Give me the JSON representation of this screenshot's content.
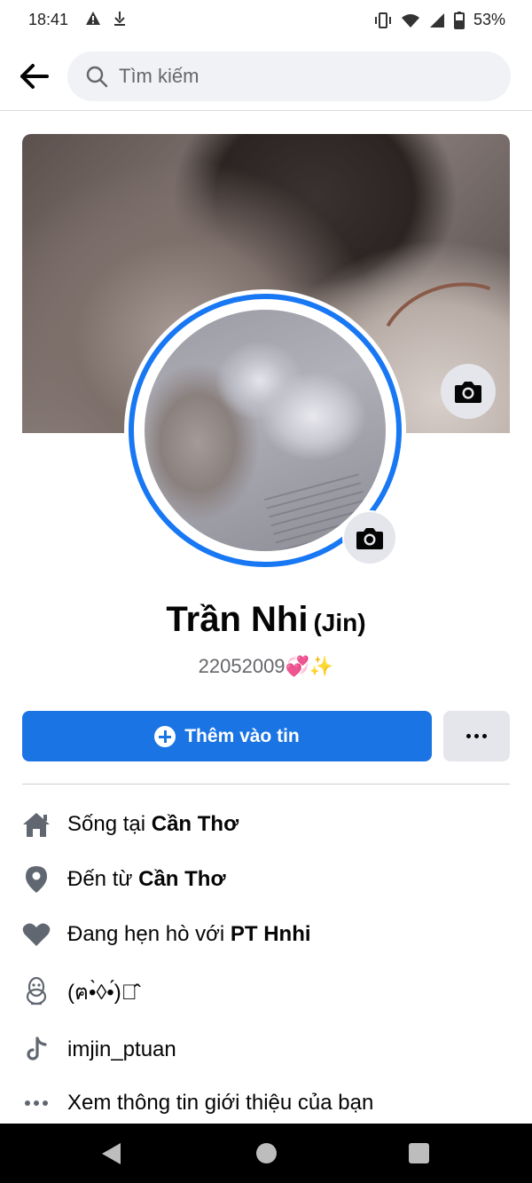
{
  "status_bar": {
    "time": "18:41",
    "battery": "53%",
    "icons": [
      "warning-icon",
      "download-icon",
      "vibrate-icon",
      "wifi-icon",
      "signal-icon",
      "battery-icon"
    ]
  },
  "search": {
    "placeholder": "Tìm kiếm"
  },
  "profile": {
    "name": "Trần Nhi",
    "alt_name": "(Jin)",
    "bio": "22052009💞✨"
  },
  "actions": {
    "add_story_label": "Thêm vào tin",
    "more_label": "..."
  },
  "info": [
    {
      "icon": "home-icon",
      "prefix": "Sống tại ",
      "bold": "Cần Thơ"
    },
    {
      "icon": "location-pin-icon",
      "prefix": "Đến từ ",
      "bold": "Cần Thơ"
    },
    {
      "icon": "heart-icon",
      "prefix": "Đang hẹn hò với ",
      "bold": "PT Hnhi"
    },
    {
      "icon": "qq-icon",
      "prefix": "(ฅ•̀◊•́)ง̂̂",
      "bold": ""
    },
    {
      "icon": "tiktok-icon",
      "prefix": "imjin_ptuan",
      "bold": ""
    },
    {
      "icon": "more-dots-icon",
      "prefix": "Xem thông tin giới thiệu của bạn",
      "bold": ""
    }
  ],
  "colors": {
    "accent": "#1b74e4",
    "avatar_ring": "#1877f2",
    "secondary_text": "#65676b"
  }
}
